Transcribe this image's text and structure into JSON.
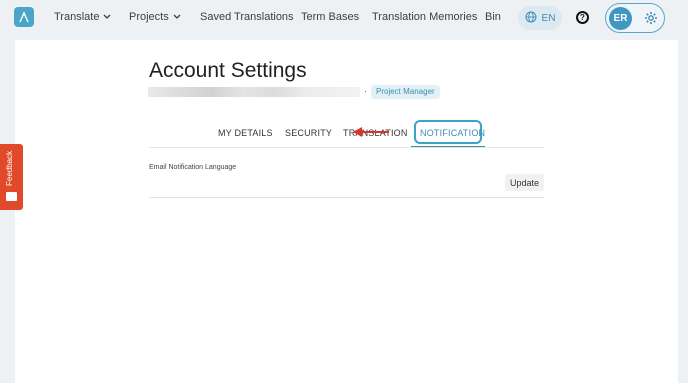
{
  "nav": {
    "items": [
      {
        "label": "Translate",
        "has_dropdown": true
      },
      {
        "label": "Projects",
        "has_dropdown": true
      },
      {
        "label": "Saved Translations"
      },
      {
        "label": "Term Bases"
      },
      {
        "label": "Translation Memories"
      },
      {
        "label": "Bin"
      }
    ],
    "language": "EN",
    "help_icon": "?",
    "user_initials": "ER"
  },
  "account": {
    "title": "Account Settings",
    "role": "Project Manager"
  },
  "tabs": [
    {
      "label": "MY DETAILS",
      "active": false
    },
    {
      "label": "SECURITY",
      "active": false
    },
    {
      "label": "TRANSLATION",
      "active": false
    },
    {
      "label": "NOTIFICATION",
      "active": true
    }
  ],
  "notification": {
    "field_label": "Email Notification Language",
    "update_label": "Update"
  },
  "feedback": {
    "label": "Feedback"
  },
  "colors": {
    "accent": "#3b8db4",
    "highlight_border": "#3aa3c8",
    "arrow": "#d9342b",
    "feedback": "#e04a2a"
  },
  "icons": [
    "logo-icon",
    "chevron-down-icon",
    "globe-icon",
    "help-icon",
    "gear-icon",
    "arrow-annotation-icon",
    "feedback-icon"
  ]
}
